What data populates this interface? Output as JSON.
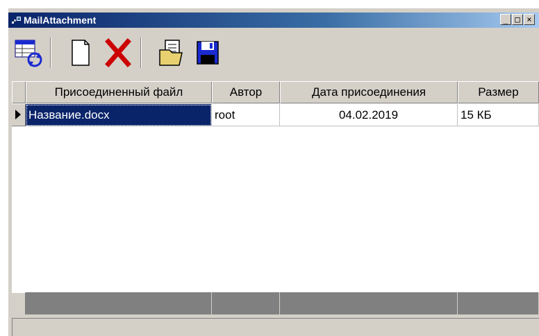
{
  "window": {
    "title": "MailAttachment",
    "controls": {
      "minimize": "_",
      "maximize": "□",
      "close": "×"
    }
  },
  "toolbar": {
    "buttons": [
      {
        "name": "refresh",
        "icon": "refresh-table-icon"
      },
      {
        "name": "new",
        "icon": "new-document-icon"
      },
      {
        "name": "delete",
        "icon": "red-x-delete-icon"
      },
      {
        "name": "open",
        "icon": "open-file-icon"
      },
      {
        "name": "save",
        "icon": "floppy-disk-icon"
      }
    ]
  },
  "table": {
    "columns": [
      "Присоединенный файл",
      "Автор",
      "Дата присоединения",
      "Размер"
    ],
    "rows": [
      {
        "file": "Название.docx",
        "author": "root",
        "date": "04.02.2019",
        "size": "15 КБ"
      }
    ]
  },
  "colors": {
    "titlebar_start": "#0a246a",
    "titlebar_end": "#a6caf0",
    "selection": "#0a246a",
    "face": "#d4d0c8",
    "delete_red": "#cc0000",
    "floppy_blue": "#1a2ad0"
  }
}
